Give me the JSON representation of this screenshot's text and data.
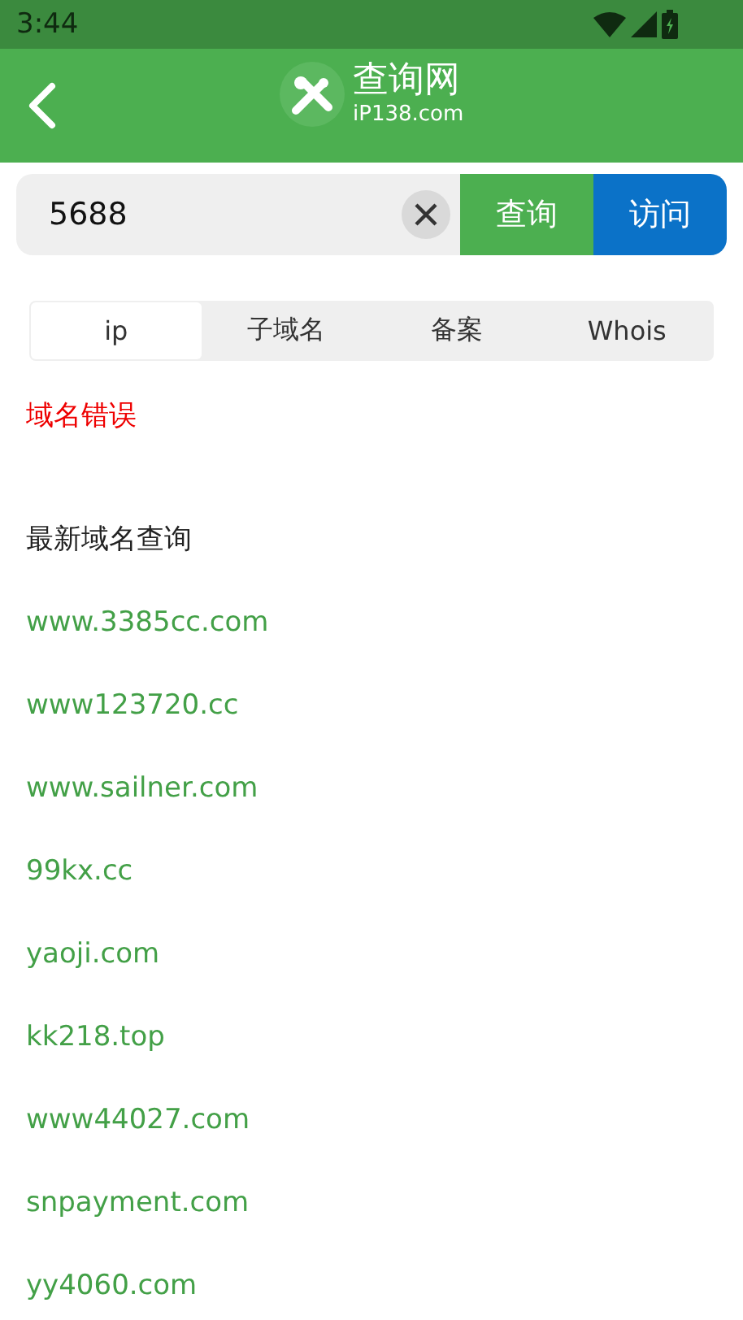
{
  "status_bar": {
    "time": "3:44"
  },
  "header": {
    "logo_title": "查询网",
    "logo_subtitle": "iP138.com"
  },
  "search": {
    "value": "5688",
    "buttons": [
      {
        "label": "查询",
        "kind": "query"
      },
      {
        "label": "访问",
        "kind": "visit"
      }
    ]
  },
  "tabs": [
    {
      "label": "ip",
      "selected": true
    },
    {
      "label": "子域名",
      "selected": false
    },
    {
      "label": "备案",
      "selected": false
    },
    {
      "label": "Whois",
      "selected": false
    }
  ],
  "error": "域名错误",
  "recent": {
    "title": "最新域名查询",
    "links": [
      "www.3385cc.com",
      "www123720.cc",
      "www.sailner.com",
      "99kx.cc",
      "yaoji.com",
      "kk218.top",
      "www44027.com",
      "snpayment.com",
      "yy4060.com"
    ]
  }
}
